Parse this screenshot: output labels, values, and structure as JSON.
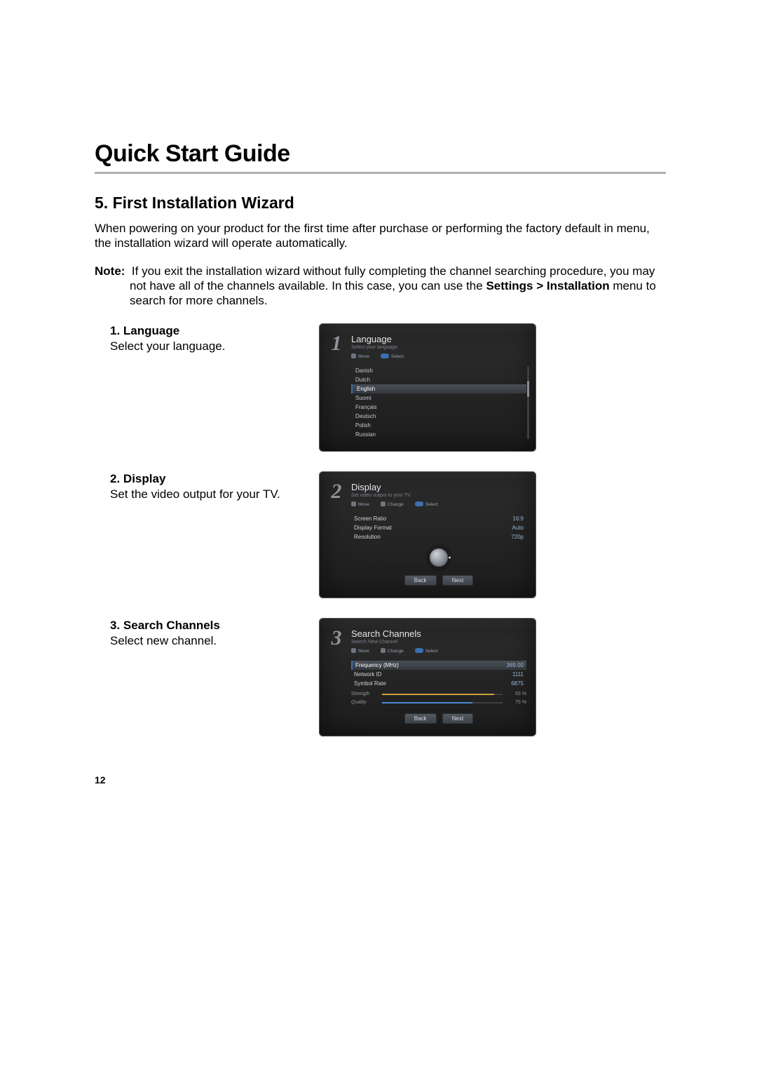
{
  "header": {
    "title": "Quick Start Guide",
    "section": "5. First Installation Wizard"
  },
  "intro": "When powering on your product for the first time after purchase or performing the factory default in menu, the installation wizard will operate automatically.",
  "note": {
    "label": "Note:",
    "body_pre": "If you exit the installation wizard without fully completing the channel searching procedure, you may not have all of the channels available. In this case, you can use the ",
    "bold": "Settings > Installation",
    "body_post": " menu to search for more channels."
  },
  "steps": [
    {
      "num": "1.",
      "title": "Language",
      "desc": "Select your language."
    },
    {
      "num": "2.",
      "title": "Display",
      "desc": "Set the video output for your TV."
    },
    {
      "num": "3.",
      "title": "Search Channels",
      "desc": "Select new channel."
    }
  ],
  "screens": {
    "lang": {
      "num": "1",
      "title": "Language",
      "sub": "Select your language.",
      "hints": {
        "move": "Move",
        "select": "Select"
      },
      "items": [
        "Danish",
        "Dutch",
        "English",
        "Suomi",
        "Français",
        "Deutsch",
        "Polish",
        "Russian"
      ],
      "selected": "English"
    },
    "display": {
      "num": "2",
      "title": "Display",
      "sub": "Set video output to your TV.",
      "hints": {
        "move": "Move",
        "change": "Change",
        "select": "Select"
      },
      "rows": [
        {
          "k": "Screen Ratio",
          "v": "16:9"
        },
        {
          "k": "Display Format",
          "v": "Auto"
        },
        {
          "k": "Resolution",
          "v": "720p"
        }
      ],
      "back": "Back",
      "next": "Next"
    },
    "search": {
      "num": "3",
      "title": "Search Channels",
      "sub": "Search New Channel",
      "hints": {
        "move": "Move",
        "change": "Change",
        "select": "Select"
      },
      "rows": [
        {
          "k": "Frequency (MHz)",
          "v": "369.00"
        },
        {
          "k": "Network ID",
          "v": "1111"
        },
        {
          "k": "Symbol Rate",
          "v": "6875"
        }
      ],
      "strength": {
        "label": "Strength",
        "value": 93,
        "text": "93 %"
      },
      "quality": {
        "label": "Quality",
        "value": 75,
        "text": "75 %"
      },
      "back": "Back",
      "next": "Next"
    }
  },
  "page_number": "12"
}
